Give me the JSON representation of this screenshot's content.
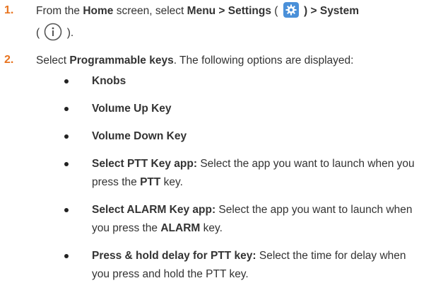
{
  "steps": [
    {
      "number": "1.",
      "text_before_home": "From the ",
      "home": "Home",
      "text_after_home": " screen, select ",
      "menu_settings": "Menu > Settings",
      "paren_open": " ( ",
      "paren_close_system": " ) > System",
      "info_open": "( ",
      "info_close": " )."
    },
    {
      "number": "2.",
      "select_word": "Select ",
      "programmable_keys": "Programmable keys",
      "after_text": ". The following options are displayed:"
    }
  ],
  "options": [
    {
      "title": "Knobs",
      "desc_parts": []
    },
    {
      "title": "Volume Up Key",
      "desc_parts": []
    },
    {
      "title": "Volume Down Key",
      "desc_parts": []
    },
    {
      "title": "Select PTT Key app:",
      "desc_1": " Select the app you want to launch when you press the ",
      "bold_1": "PTT",
      "desc_2": " key."
    },
    {
      "title": "Select ALARM Key app:",
      "desc_1": " Select the app you want to launch when you press the ",
      "bold_1": "ALARM",
      "desc_2": " key."
    },
    {
      "title": "Press & hold delay for PTT key:",
      "desc_1": " Select the time for delay when you press and hold the PTT key.",
      "bold_1": "",
      "desc_2": ""
    }
  ],
  "icons": {
    "settings": "gear-icon",
    "system": "info-icon",
    "gear_bg": "#4a90d9",
    "step_number_color": "#e8731e"
  }
}
